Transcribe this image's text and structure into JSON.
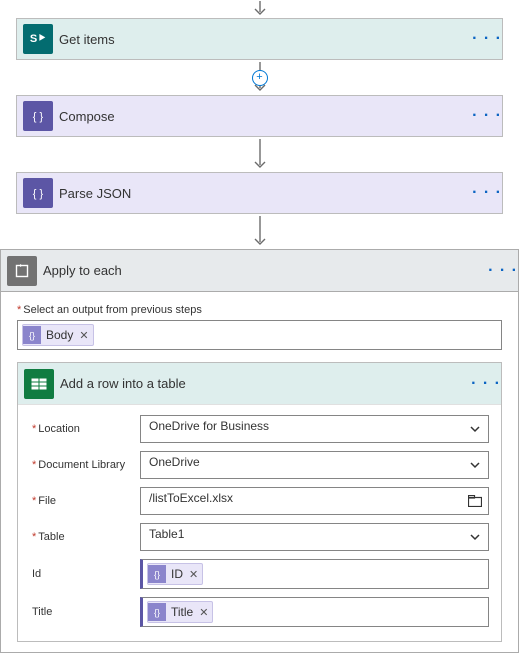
{
  "steps": {
    "getItems": {
      "title": "Get items"
    },
    "compose": {
      "title": "Compose"
    },
    "parseJson": {
      "title": "Parse JSON"
    },
    "applyEach": {
      "title": "Apply to each",
      "outputLabel": "Select an output from previous steps",
      "bodyToken": "Body"
    },
    "addRow": {
      "title": "Add a row into a table",
      "fields": {
        "location": {
          "label": "Location",
          "value": "OneDrive for Business"
        },
        "library": {
          "label": "Document Library",
          "value": "OneDrive"
        },
        "file": {
          "label": "File",
          "value": "/listToExcel.xlsx"
        },
        "table": {
          "label": "Table",
          "value": "Table1"
        },
        "id": {
          "label": "Id",
          "token": "ID"
        },
        "titleF": {
          "label": "Title",
          "token": "Title"
        }
      }
    }
  },
  "glyphs": {
    "ellipsis": "· · ·",
    "remove": "✕",
    "plus": "+"
  }
}
